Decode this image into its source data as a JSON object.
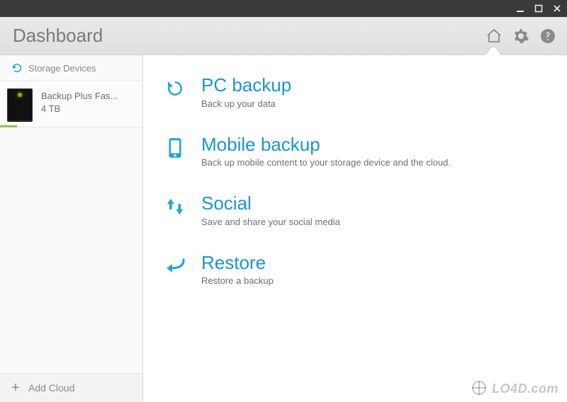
{
  "header": {
    "title": "Dashboard"
  },
  "sidebar": {
    "section_label": "Storage Devices",
    "devices": [
      {
        "name": "Backup Plus Fas...",
        "capacity": "4 TB",
        "used_percent": 12
      }
    ],
    "add_cloud_label": "Add Cloud"
  },
  "actions": [
    {
      "key": "pc-backup",
      "title": "PC backup",
      "description": "Back up your data"
    },
    {
      "key": "mobile-backup",
      "title": "Mobile backup",
      "description": "Back up mobile content to your storage device and the cloud."
    },
    {
      "key": "social",
      "title": "Social",
      "description": "Save and share your social media"
    },
    {
      "key": "restore",
      "title": "Restore",
      "description": "Restore a backup"
    }
  ],
  "watermark": "LO4D.com"
}
